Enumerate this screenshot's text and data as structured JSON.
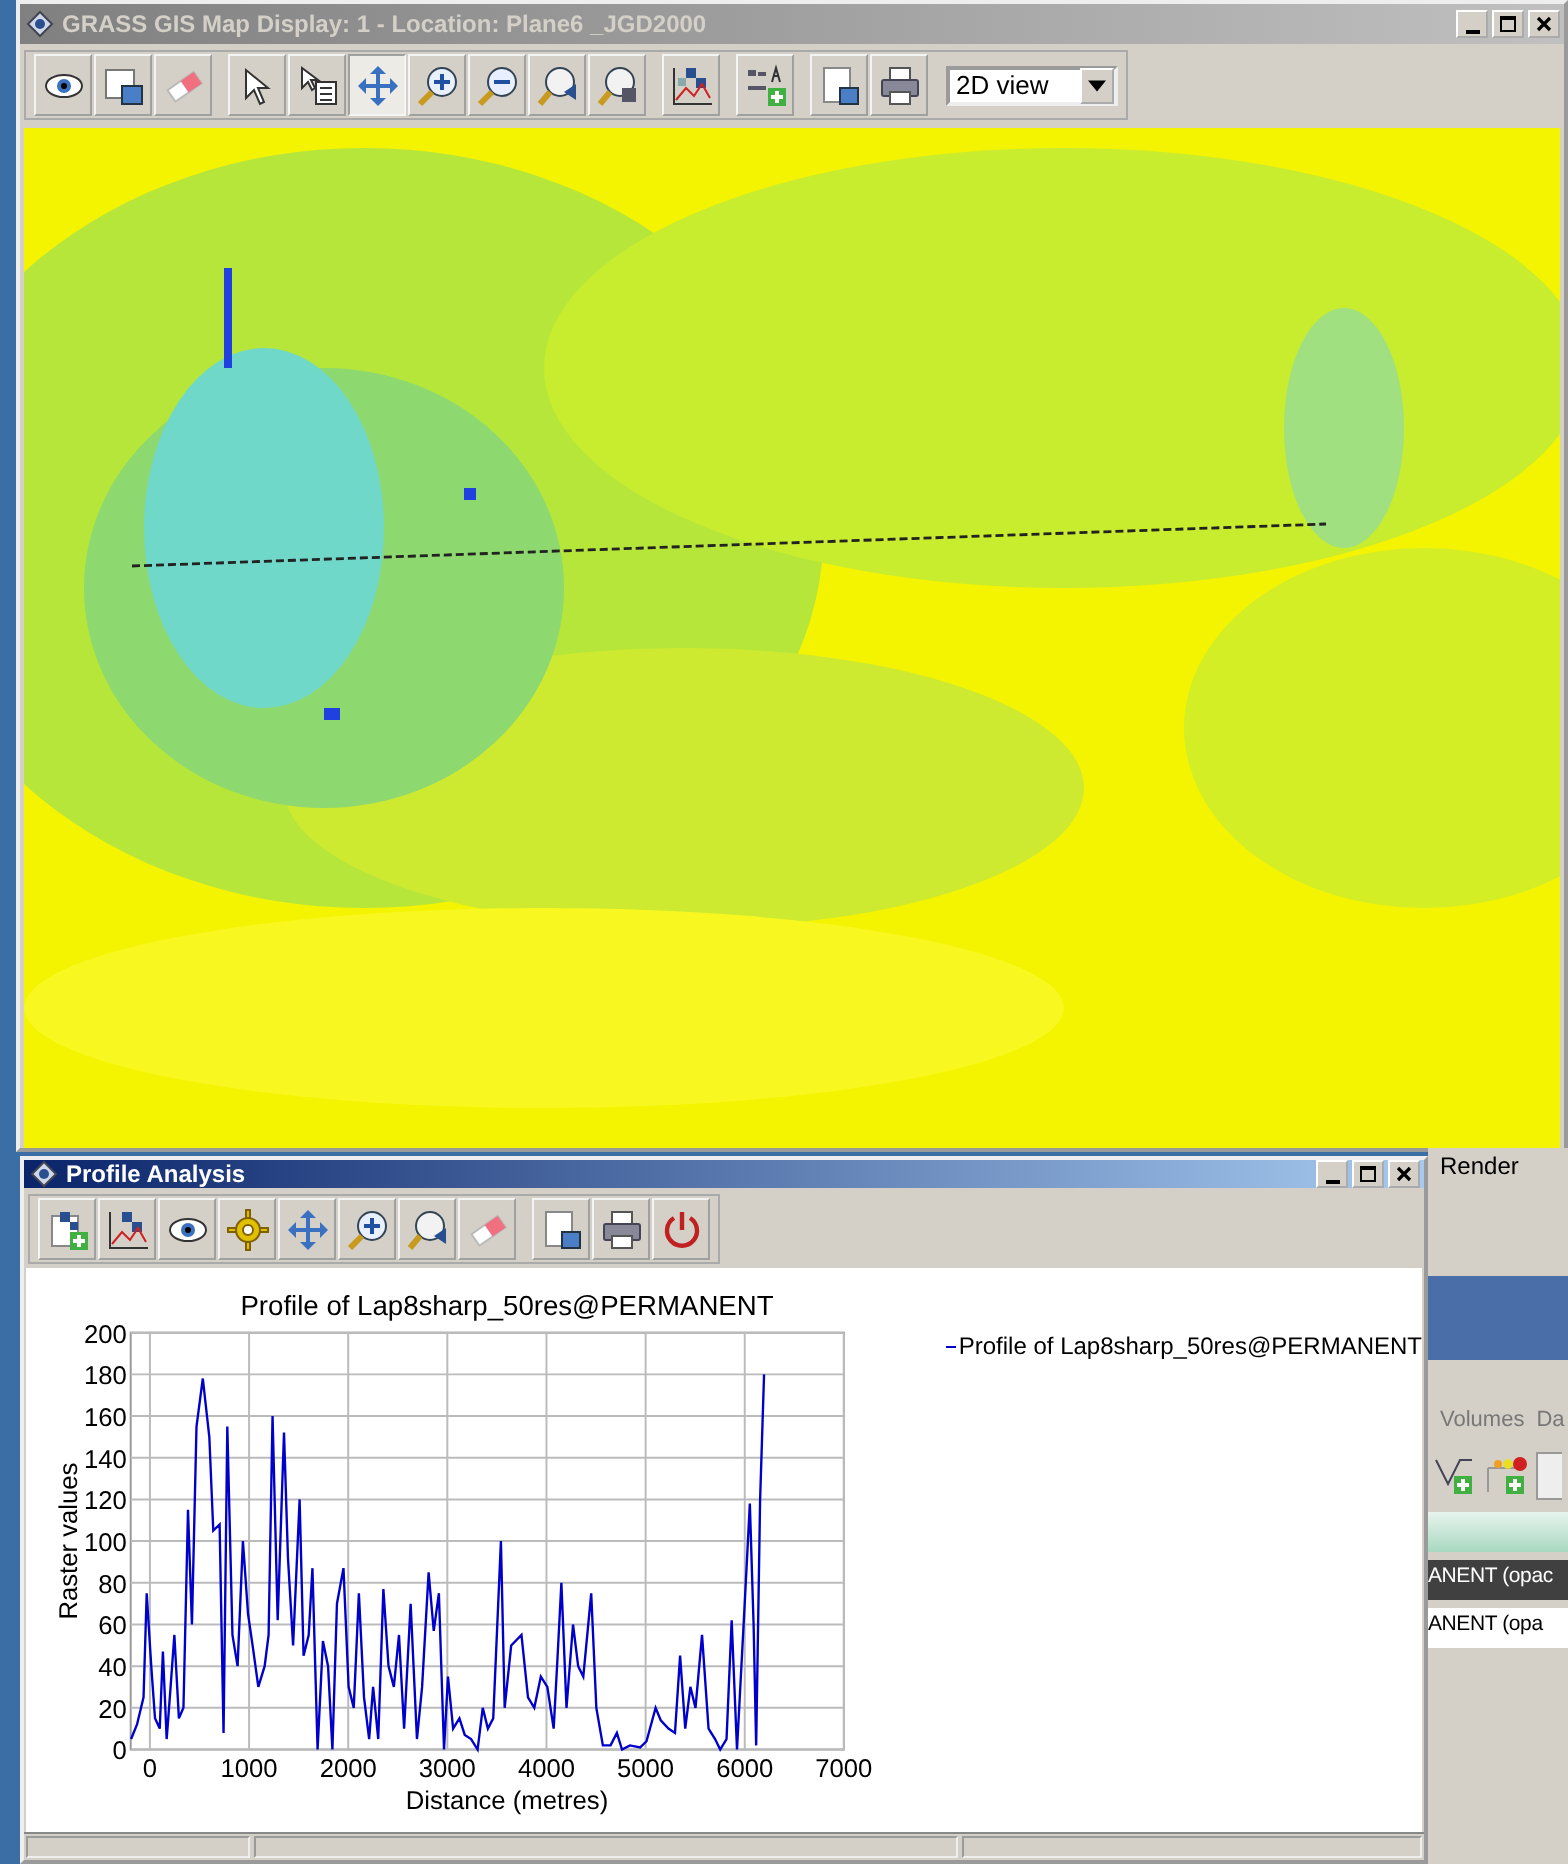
{
  "map_window": {
    "title": "GRASS GIS Map Display: 1 - Location: Plane6 _JGD2000",
    "toolbar": [
      {
        "kind": "display",
        "selected": false
      },
      {
        "kind": "add-overlay",
        "selected": false
      },
      {
        "kind": "erase",
        "selected": false
      },
      {
        "kind": "separator"
      },
      {
        "kind": "pointer",
        "selected": false
      },
      {
        "kind": "query",
        "selected": false
      },
      {
        "kind": "pan",
        "selected": true
      },
      {
        "kind": "zoom-in",
        "selected": false
      },
      {
        "kind": "zoom-out",
        "selected": false
      },
      {
        "kind": "zoom-back",
        "selected": false
      },
      {
        "kind": "zoom-menu",
        "selected": false
      },
      {
        "kind": "separator"
      },
      {
        "kind": "analyze",
        "selected": false
      },
      {
        "kind": "separator"
      },
      {
        "kind": "decorate",
        "selected": false
      },
      {
        "kind": "separator"
      },
      {
        "kind": "save",
        "selected": false
      },
      {
        "kind": "print",
        "selected": false
      }
    ],
    "view_select": {
      "value": "2D view"
    }
  },
  "background_window": {
    "render_label": "Render",
    "tabs": [
      "Volumes",
      "Da"
    ],
    "layers": [
      {
        "text": "ANENT (opac",
        "selected": true
      },
      {
        "text": "ANENT (opa",
        "selected": false
      }
    ]
  },
  "profile_window": {
    "title": "Profile Analysis",
    "toolbar": [
      {
        "kind": "add-raster"
      },
      {
        "kind": "draw"
      },
      {
        "kind": "display"
      },
      {
        "kind": "settings"
      },
      {
        "kind": "pan"
      },
      {
        "kind": "zoom-in"
      },
      {
        "kind": "zoom-back"
      },
      {
        "kind": "erase"
      },
      {
        "kind": "separator"
      },
      {
        "kind": "save"
      },
      {
        "kind": "print"
      },
      {
        "kind": "quit"
      }
    ],
    "chart_data": {
      "type": "line",
      "title": "Profile of Lap8sharp_50res@PERMANENT",
      "xlabel": "Distance (metres)",
      "ylabel": "Raster values",
      "grid": true,
      "xlim": [
        -194,
        7000
      ],
      "ylim": [
        0,
        200
      ],
      "xticks": [
        0,
        1000,
        2000,
        3000,
        4000,
        5000,
        6000,
        7000
      ],
      "yticks": [
        0,
        20,
        40,
        60,
        80,
        100,
        120,
        140,
        160,
        180,
        200
      ],
      "x": [
        -190,
        -130,
        -65,
        -32,
        13,
        52,
        98,
        130,
        169,
        208,
        247,
        293,
        339,
        384,
        423,
        469,
        534,
        599,
        638,
        703,
        742,
        781,
        833,
        885,
        937,
        989,
        1041,
        1093,
        1158,
        1197,
        1236,
        1288,
        1353,
        1393,
        1445,
        1510,
        1549,
        1601,
        1640,
        1692,
        1744,
        1796,
        1841,
        1887,
        1952,
        2004,
        2056,
        2108,
        2160,
        2212,
        2251,
        2303,
        2355,
        2407,
        2460,
        2512,
        2564,
        2629,
        2694,
        2746,
        2811,
        2863,
        2915,
        2967,
        3006,
        3058,
        3123,
        3175,
        3240,
        3305,
        3357,
        3409,
        3462,
        3540,
        3579,
        3644,
        3748,
        3813,
        3878,
        3943,
        4008,
        4073,
        4112,
        4151,
        4203,
        4268,
        4320,
        4372,
        4451,
        4503,
        4568,
        4646,
        4711,
        4763,
        4841,
        4945,
        5010,
        5101,
        5153,
        5231,
        5296,
        5348,
        5400,
        5452,
        5504,
        5569,
        5634,
        5700,
        5752,
        5817,
        5869,
        5921,
        5999,
        6051,
        6090,
        6116,
        6155,
        6194
      ],
      "series": [
        {
          "name": "Profile of Lap8sharp_50res@PERMANENT",
          "color": "#0000cc",
          "values": [
            5,
            12,
            25,
            75,
            40,
            15,
            10,
            47,
            5,
            30,
            55,
            15,
            20,
            115,
            60,
            155,
            178,
            150,
            105,
            108,
            8,
            155,
            55,
            40,
            100,
            65,
            48,
            30,
            40,
            55,
            160,
            62,
            152,
            92,
            50,
            120,
            45,
            55,
            87,
            0,
            52,
            40,
            0,
            70,
            87,
            30,
            20,
            75,
            25,
            5,
            30,
            5,
            77,
            40,
            30,
            55,
            10,
            70,
            5,
            30,
            85,
            57,
            75,
            0,
            35,
            10,
            15,
            7,
            5,
            0,
            20,
            10,
            15,
            100,
            20,
            50,
            55,
            25,
            20,
            35,
            30,
            10,
            45,
            80,
            20,
            60,
            40,
            35,
            75,
            20,
            2,
            2,
            8,
            0,
            2,
            1,
            4,
            20,
            14,
            10,
            8,
            45,
            10,
            30,
            20,
            55,
            10,
            5,
            0,
            5,
            62,
            0,
            70,
            118,
            60,
            2,
            120,
            180
          ]
        }
      ]
    }
  }
}
